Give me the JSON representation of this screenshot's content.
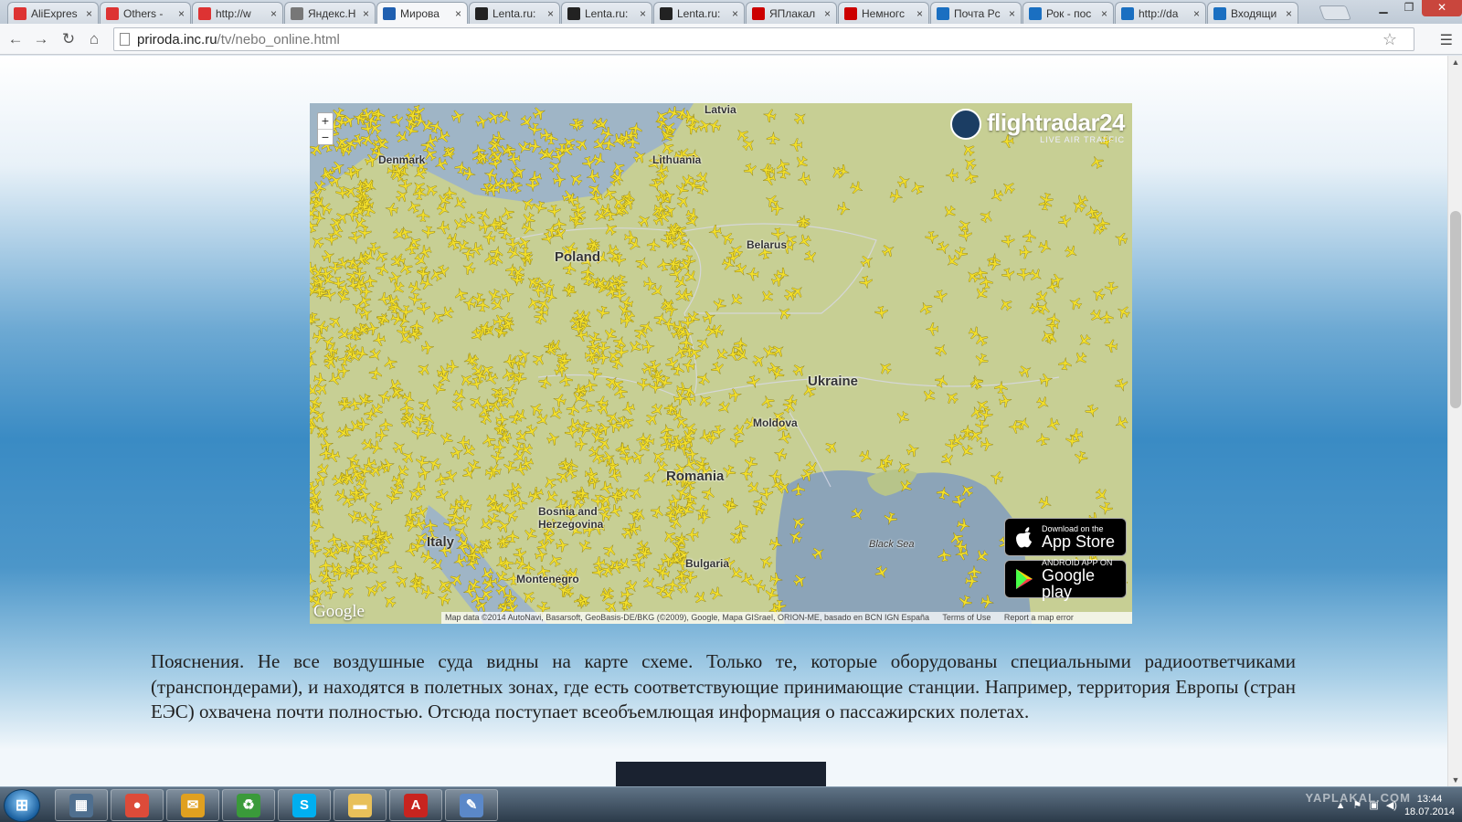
{
  "browser": {
    "tabs": [
      {
        "title": "AliExpres",
        "favicon": "aliexpress-icon",
        "color": "#d33",
        "active": false
      },
      {
        "title": "Others - ",
        "favicon": "aliexpress-icon",
        "color": "#d33",
        "active": false
      },
      {
        "title": "http://w",
        "favicon": "aliexpress-icon",
        "color": "#d33",
        "active": false
      },
      {
        "title": "Яндекс.Н",
        "favicon": "document-icon",
        "color": "#777",
        "active": false
      },
      {
        "title": "Мирова",
        "favicon": "globe-icon",
        "color": "#1f5fb0",
        "active": true
      },
      {
        "title": "Lenta.ru:",
        "favicon": "lenta-icon",
        "color": "#222",
        "active": false
      },
      {
        "title": "Lenta.ru:",
        "favicon": "lenta-icon",
        "color": "#222",
        "active": false
      },
      {
        "title": "Lenta.ru:",
        "favicon": "lenta-icon",
        "color": "#222",
        "active": false
      },
      {
        "title": "ЯПлакал",
        "favicon": "yaplakal-icon",
        "color": "#c00",
        "active": false
      },
      {
        "title": "Немногс",
        "favicon": "yaplakal-icon",
        "color": "#c00",
        "active": false
      },
      {
        "title": "Почта Рс",
        "favicon": "mail-ru-icon",
        "color": "#1a6fc1",
        "active": false
      },
      {
        "title": "Рок - пос",
        "favicon": "music-icon",
        "color": "#1a6fc1",
        "active": false
      },
      {
        "title": "http://da",
        "favicon": "link-icon",
        "color": "#1a6fc1",
        "active": false
      },
      {
        "title": "Входящи",
        "favicon": "inbox-icon",
        "color": "#1a6fc1",
        "active": false
      }
    ],
    "tab_close": "×",
    "url_host": "priroda.inc.ru",
    "url_path": "/tv/nebo_online.html"
  },
  "map": {
    "brand": "flightradar24",
    "brand_sub": "LIVE AIR TRAFFIC",
    "zoom_in": "+",
    "zoom_out": "−",
    "labels": [
      {
        "text": "Latvia",
        "cls": "",
        "name": "label-latvia"
      },
      {
        "text": "Lithuania",
        "cls": "",
        "name": "label-lithuania"
      },
      {
        "text": "Denmark",
        "cls": "",
        "name": "label-denmark"
      },
      {
        "text": "Poland",
        "cls": "big",
        "name": "label-poland"
      },
      {
        "text": "Belarus",
        "cls": "",
        "name": "label-belarus"
      },
      {
        "text": "Ukraine",
        "cls": "big",
        "name": "label-ukraine"
      },
      {
        "text": "Moldova",
        "cls": "",
        "name": "label-moldova"
      },
      {
        "text": "Romania",
        "cls": "big",
        "name": "label-romania"
      },
      {
        "text": "Bosnia and Herzegovina",
        "cls": "",
        "name": "label-bosnia"
      },
      {
        "text": "Italy",
        "cls": "big",
        "name": "label-italy"
      },
      {
        "text": "Black Sea",
        "cls": "sea",
        "name": "label-black-sea"
      },
      {
        "text": "Montenegro",
        "cls": "",
        "name": "label-montenegro"
      },
      {
        "text": "Bulgaria",
        "cls": "",
        "name": "label-bulgaria"
      }
    ],
    "appstore_small": "Download on the",
    "appstore_big": "App Store",
    "googleplay_small": "ANDROID APP ON",
    "googleplay_big": "Google play",
    "google_logo": "Google",
    "attribution": "Map data ©2014 AutoNavi, Basarsoft, GeoBasis-DE/BKG (©2009), Google, Mapa GISrael, ORION-ME, basado en BCN IGN España",
    "terms": "Terms of Use",
    "report": "Report a map error"
  },
  "article": {
    "text": "Пояснения. Не все воздушные суда видны на карте схеме. Только те, которые оборудованы специальными радиоответчиками (транспондерами), и находятся в полетных зонах, где есть соответствующие принимающие станции. Например, территория Европы (стран ЕЭС) охвачена почти полностью. Отсюда поступает всеобъемлющая информация о пассажирских полетах."
  },
  "taskbar": {
    "start_label": "⊞",
    "apps": [
      {
        "name": "windows-explorer-icon",
        "glyph": "▦",
        "color": "#4f6f8f"
      },
      {
        "name": "chrome-icon",
        "glyph": "●",
        "color": "#dd4b39"
      },
      {
        "name": "outlook-icon",
        "glyph": "✉",
        "color": "#e0a020"
      },
      {
        "name": "recycle-icon",
        "glyph": "♻",
        "color": "#3a9a3a"
      },
      {
        "name": "skype-icon",
        "glyph": "S",
        "color": "#00aff0"
      },
      {
        "name": "folder-icon",
        "glyph": "▬",
        "color": "#e8c05a"
      },
      {
        "name": "acrobat-icon",
        "glyph": "A",
        "color": "#c8241f"
      },
      {
        "name": "paint-icon",
        "glyph": "✎",
        "color": "#5b88c8"
      }
    ],
    "watermark": "YAPLAKAL.COM",
    "time": "13:44",
    "date": "18.07.2014"
  }
}
